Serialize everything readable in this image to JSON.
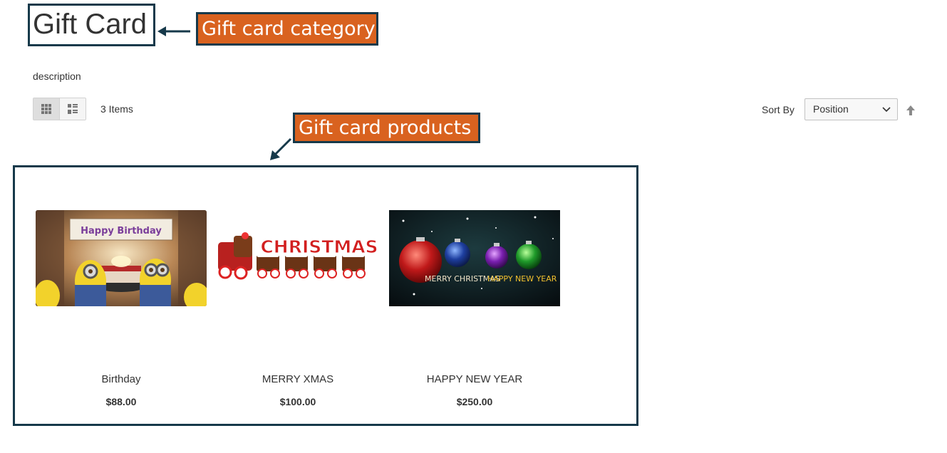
{
  "category": {
    "title": "Gift Card",
    "description": "description"
  },
  "annotations": {
    "category_label": "Gift card category",
    "products_label": "Gift card products"
  },
  "toolbar": {
    "modes": [
      {
        "name": "grid",
        "icon": "grid-icon",
        "active": true
      },
      {
        "name": "list",
        "icon": "list-icon",
        "active": false
      }
    ],
    "item_count": "3 Items",
    "sort_label": "Sort By",
    "sort_selected": "Position",
    "sort_direction_icon": "arrow-up-icon"
  },
  "products": [
    {
      "name": "Birthday",
      "price": "$88.00",
      "image_text": "Happy Birthday"
    },
    {
      "name": "MERRY XMAS",
      "price": "$100.00",
      "image_text": "CHRISTMAS"
    },
    {
      "name": "HAPPY NEW YEAR",
      "price": "$250.00",
      "image_text_1": "MERRY CHRISTMAS",
      "image_text_2": "HAPPY NEW YEAR"
    }
  ],
  "colors": {
    "annotation_orange": "#d9621f",
    "annotation_border": "#16394a"
  }
}
